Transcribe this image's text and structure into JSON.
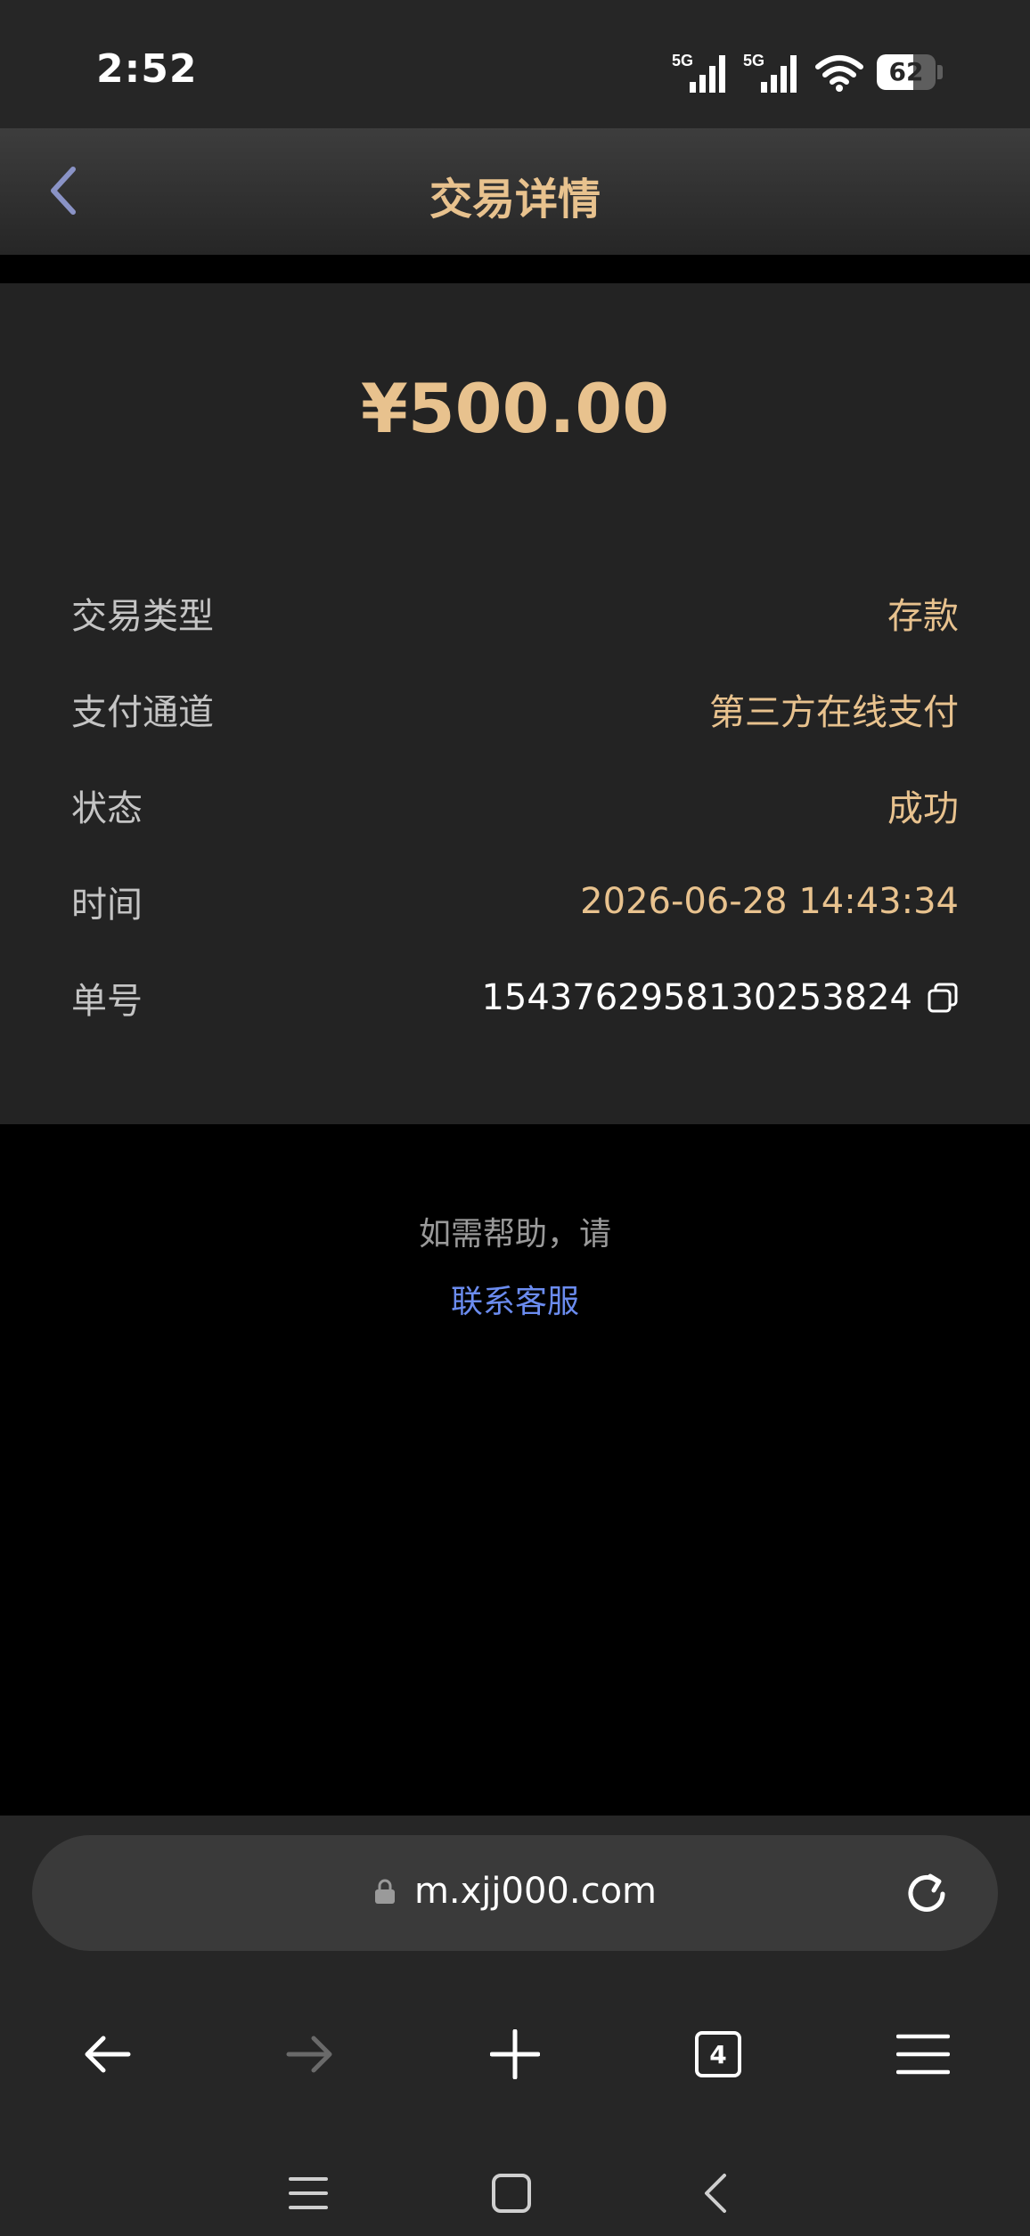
{
  "status_bar": {
    "time": "2:52",
    "network_1": "5G",
    "network_2": "5G",
    "battery_level": "62",
    "battery_fraction": 0.62
  },
  "header": {
    "title": "交易详情",
    "back_icon": "chevron-left-icon"
  },
  "transaction": {
    "amount": "¥500.00",
    "rows": [
      {
        "label": "交易类型",
        "value": "存款"
      },
      {
        "label": "支付通道",
        "value": "第三方在线支付"
      },
      {
        "label": "状态",
        "value": "成功"
      },
      {
        "label": "时间",
        "value": "2026-06-28 14:43:34"
      },
      {
        "label": "单号",
        "value": "1543762958130253824"
      }
    ]
  },
  "help": {
    "text": "如需帮助，请",
    "link": "联系客服"
  },
  "browser": {
    "url": "m.xjj000.com",
    "tab_count": "4"
  },
  "colors": {
    "accent_gold": "#e8c28e",
    "link_blue": "#6b8cf0",
    "background": "#000000",
    "card": "#232323"
  }
}
